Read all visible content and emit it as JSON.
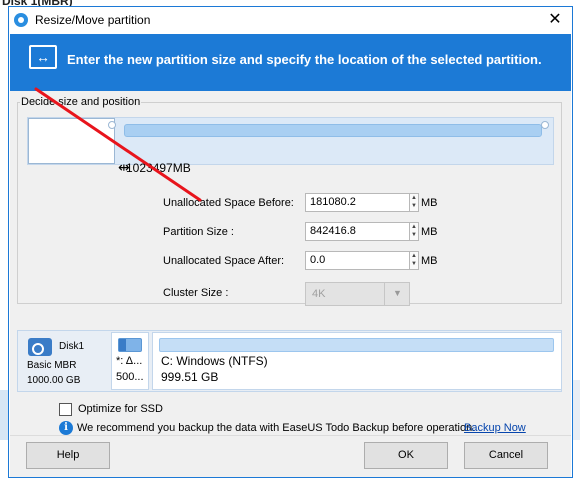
{
  "background": {
    "title": "Disk 1(MBR)"
  },
  "window": {
    "title": "Resize/Move partition",
    "close_glyph": "✕"
  },
  "banner": {
    "text": "Enter the new partition size and specify the location of the selected partition.",
    "icon": "resize-arrows-icon",
    "color": "#1c7ad6"
  },
  "decide": {
    "group_label": "Decide size and position",
    "partition_size_label": "1023497MB",
    "fields": [
      {
        "label": "Unallocated Space Before:",
        "value": "181080.2",
        "unit": "MB"
      },
      {
        "label": "Partition Size :",
        "value": "842416.8",
        "unit": "MB"
      },
      {
        "label": "Unallocated Space After:",
        "value": "0.0",
        "unit": "MB"
      }
    ],
    "cluster": {
      "label": "Cluster Size :",
      "value": "4K"
    }
  },
  "diskmap": {
    "disk_name": "Disk1",
    "disk_type": "Basic MBR",
    "disk_size": "1000.00 GB",
    "partitions": [
      {
        "name": "*: Δ...",
        "size": "500..."
      },
      {
        "name": "C: Windows (NTFS)",
        "size": "999.51 GB"
      }
    ]
  },
  "options": {
    "optimize_ssd": "Optimize for SSD",
    "info_text": "We recommend you backup the data with EaseUS Todo Backup before operation.",
    "backup_link": "Backup Now"
  },
  "buttons": {
    "help": "Help",
    "ok": "OK",
    "cancel": "Cancel"
  },
  "colors": {
    "annotation_line": "#e8141c",
    "window_border": "#1c79d6"
  }
}
